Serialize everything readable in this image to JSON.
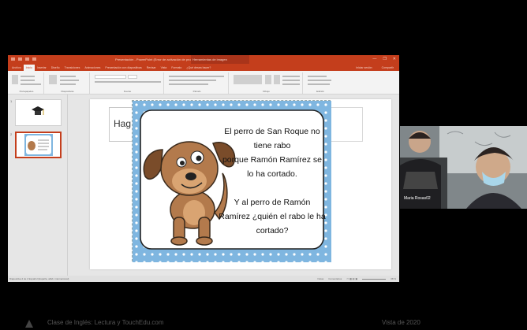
{
  "window": {
    "title": "Presentación - PowerPoint (Error de activación de productos)",
    "context_tab": "Herramientas de imagen",
    "window_controls": [
      "—",
      "❐",
      "✕"
    ]
  },
  "tabs": [
    "Archivo",
    "Inicio",
    "Insertar",
    "Diseño",
    "Transiciones",
    "Animaciones",
    "Presentación con diapositivas",
    "Revisar",
    "Vista",
    "Formato",
    "¿Qué desea hacer?"
  ],
  "tabs_right": [
    "Iniciar sesión",
    "Compartir"
  ],
  "active_tab_index": 1,
  "ribbon_groups": [
    "Portapapeles",
    "Diapositivas",
    "Fuente",
    "Párrafo",
    "Dibujo",
    "Edición"
  ],
  "thumbnails": [
    {
      "num": "1",
      "selected": false
    },
    {
      "num": "2",
      "selected": true
    }
  ],
  "slide": {
    "title_placeholder": "Hag",
    "card_text": [
      "El perro de San Roque no",
      "tiene rabo",
      "porque Ramón Ramírez se",
      "lo ha cortado.",
      "",
      "Y al perro de Ramón",
      "Ramírez ¿quién el rabo le ha",
      "cortado?"
    ]
  },
  "statusbar": {
    "left": "Diapositiva 2 de 2   Español (España, alfab. internacional)",
    "notes": "Notas",
    "comments": "Comentarios",
    "zoom": "38 %"
  },
  "video": {
    "participant_name": "Maria Rosas02"
  },
  "bottom": {
    "left_text": "Clase de Inglés: Lectura y TouchEdu.com",
    "right_text": "Vista de 2020"
  },
  "colors": {
    "ppt_accent": "#c43e1c",
    "card_border_blue": "#7fb6e0",
    "dog_brown": "#b37a4c"
  }
}
